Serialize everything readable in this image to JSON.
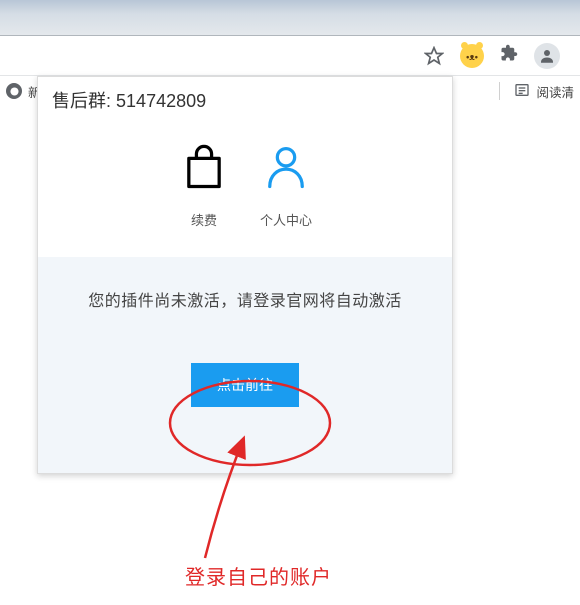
{
  "toolbar": {
    "bookmark_fragment": "新",
    "reading_list": "阅读清"
  },
  "popup": {
    "header_label": "售后群:",
    "header_number": "514742809",
    "renew_label": "续费",
    "personal_center_label": "个人中心",
    "activation_message": "您的插件尚未激活，请登录官网将自动激活",
    "go_button_label": "点击前往"
  },
  "annotation": {
    "caption": "登录自己的账户"
  },
  "colors": {
    "primary_blue": "#1a9cf0",
    "annotation_red": "#e02828"
  }
}
